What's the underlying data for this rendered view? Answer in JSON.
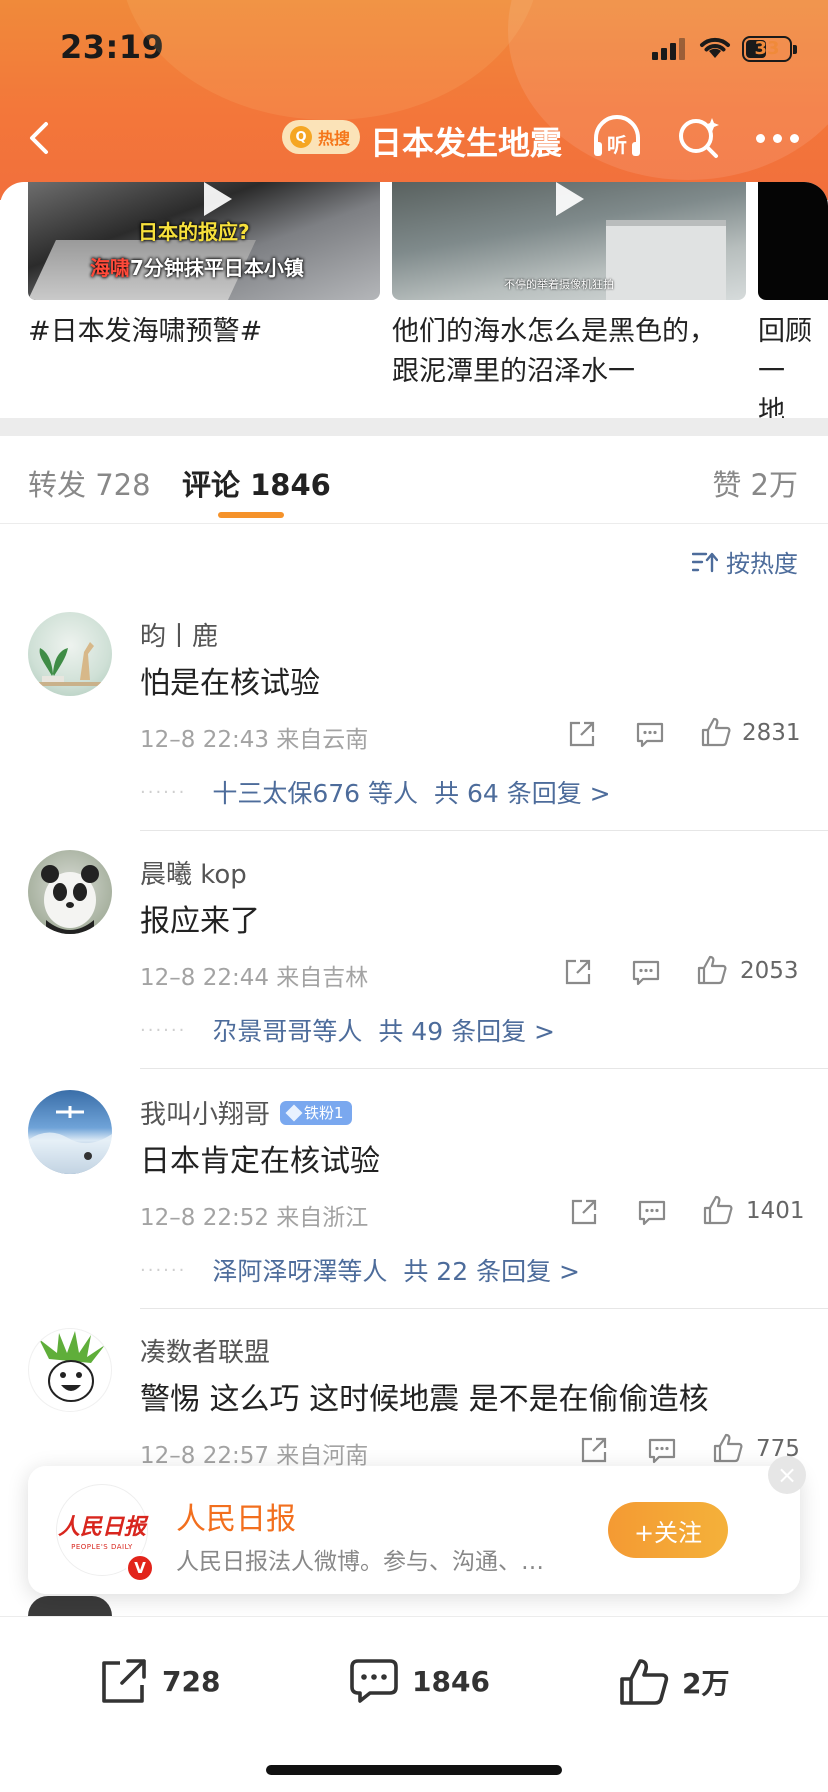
{
  "status_bar": {
    "time": "23:19",
    "battery": "33"
  },
  "nav": {
    "hot_badge": "热搜",
    "title": "日本发生地震",
    "listen_label": "听"
  },
  "videos": [
    {
      "caption_top": "日本的报应?",
      "caption_red": "海啸",
      "caption_rest": "7分钟抹平日本小镇",
      "title": "#日本发海啸预警#"
    },
    {
      "caption_small": "不停的举着摄像机狂拍",
      "title": "他们的海水怎么是黑色的，跟泥潭里的沼泽水一"
    },
    {
      "title": "回顾一地震，"
    }
  ],
  "tabs": {
    "repost": "转发 728",
    "comment": "评论 1846",
    "like": "赞 2万"
  },
  "sort_label": "按热度",
  "comments": [
    {
      "user": "昀丨鹿",
      "text": "怕是在核试验",
      "meta": "12–8 22:43 来自云南",
      "likes": "2831",
      "reply_who": "十三太保676 等人",
      "reply_total": "共 64 条回复 >"
    },
    {
      "user": "晨曦 kop",
      "text": "报应来了",
      "meta": "12–8 22:44 来自吉林",
      "likes": "2053",
      "reply_who": "尕景哥哥等人",
      "reply_total": "共 49 条回复 >"
    },
    {
      "user": "我叫小翔哥",
      "badge": "铁粉1",
      "text": "日本肯定在核试验",
      "meta": "12–8 22:52 来自浙江",
      "likes": "1401",
      "reply_who": "泽阿泽呀澤等人",
      "reply_total": "共 22 条回复 >"
    },
    {
      "user": "凑数者联盟",
      "text": "警惕 这么巧 这时候地震 是不是在偷偷造核",
      "meta": "12–8 22:57 来自河南",
      "likes": "775"
    }
  ],
  "promo": {
    "logo_cn": "人民日报",
    "logo_en": "PEOPLE'S DAILY",
    "name": "人民日报",
    "desc": "人民日报法人微博。参与、沟通、…",
    "follow": "+关注"
  },
  "bottom_bar": {
    "repost": "728",
    "comment": "1846",
    "like": "2万"
  },
  "colors": {
    "header_orange": "#f3773a",
    "link_blue": "#4d6c9b",
    "accent_orange": "#f5922a",
    "brand_red": "#d8261e"
  }
}
